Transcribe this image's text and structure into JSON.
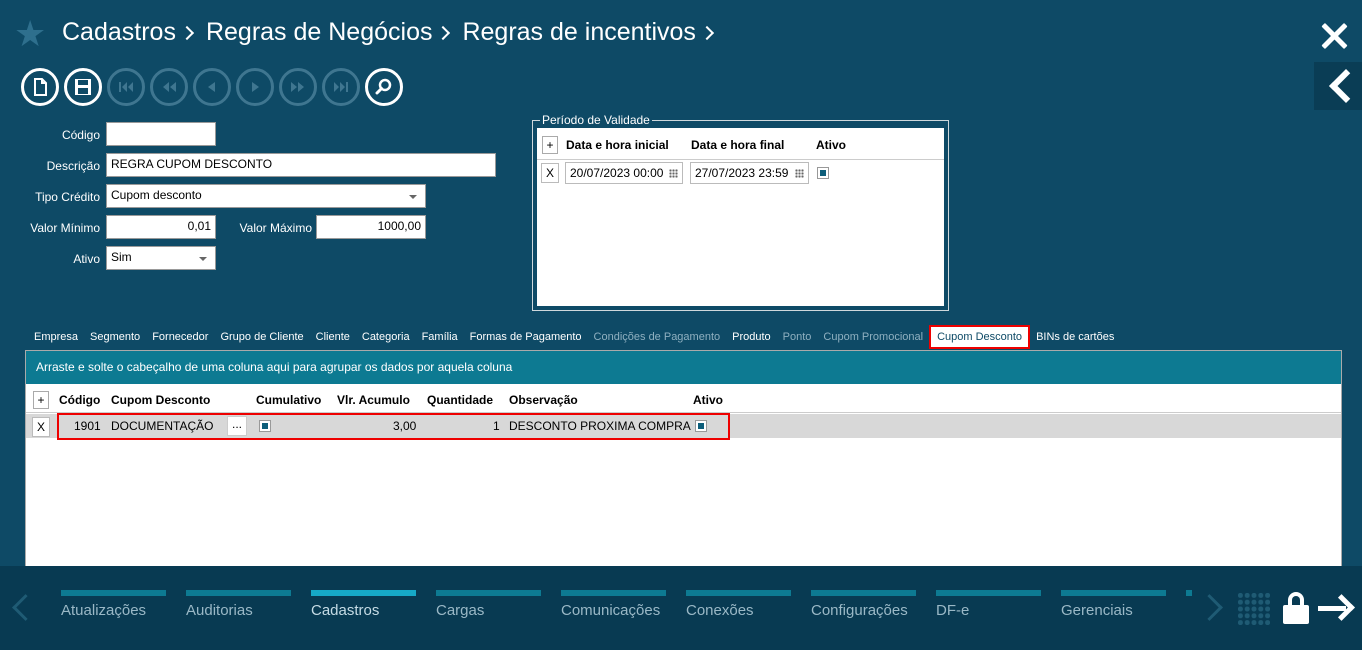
{
  "breadcrumb": [
    "Cadastros",
    "Regras de Negócios",
    "Regras de incentivos"
  ],
  "form": {
    "codigo_label": "Código",
    "codigo_value": "",
    "descricao_label": "Descrição",
    "descricao_value": "REGRA CUPOM DESCONTO",
    "tipo_credito_label": "Tipo Crédito",
    "tipo_credito_value": "Cupom desconto",
    "valor_minimo_label": "Valor Mínimo",
    "valor_minimo_value": "0,01",
    "valor_maximo_label": "Valor Máximo",
    "valor_maximo_value": "1000,00",
    "ativo_label": "Ativo",
    "ativo_value": "Sim"
  },
  "periodo": {
    "legend": "Período de Validade",
    "add": "+",
    "col_inicio": "Data e hora inicial",
    "col_fim": "Data e hora final",
    "col_ativo": "Ativo",
    "rows": [
      {
        "remove": "X",
        "inicio": "20/07/2023 00:00",
        "fim": "27/07/2023 23:59",
        "ativo": true
      }
    ]
  },
  "tabs": [
    {
      "label": "Empresa",
      "state": "normal"
    },
    {
      "label": "Segmento",
      "state": "normal"
    },
    {
      "label": "Fornecedor",
      "state": "normal"
    },
    {
      "label": "Grupo de Cliente",
      "state": "normal"
    },
    {
      "label": "Cliente",
      "state": "normal"
    },
    {
      "label": "Categoria",
      "state": "normal"
    },
    {
      "label": "Família",
      "state": "normal"
    },
    {
      "label": "Formas de Pagamento",
      "state": "normal"
    },
    {
      "label": "Condições de Pagamento",
      "state": "disabled"
    },
    {
      "label": "Produto",
      "state": "normal"
    },
    {
      "label": "Ponto",
      "state": "disabled"
    },
    {
      "label": "Cupom Promocional",
      "state": "disabled"
    },
    {
      "label": "Cupom Desconto",
      "state": "active"
    },
    {
      "label": "BINs de cartões",
      "state": "normal"
    }
  ],
  "cupom_grid": {
    "group_hint": "Arraste e solte o cabeçalho de uma coluna aqui para agrupar os dados por aquela coluna",
    "add": "+",
    "col_codigo": "Código",
    "col_cupom": "Cupom Desconto",
    "col_cumulativo": "Cumulativo",
    "col_vlr_acumulo": "Vlr. Acumulo",
    "col_quantidade": "Quantidade",
    "col_observacao": "Observação",
    "col_ativo": "Ativo",
    "rows": [
      {
        "remove": "X",
        "codigo": "1901",
        "cupom": "DOCUMENTAÇÃO",
        "lookup": "...",
        "cumulativo": true,
        "vlr_acumulo": "3,00",
        "quantidade": "1",
        "observacao": "DESCONTO PROXIMA COMPRA",
        "ativo": true
      }
    ]
  },
  "bottom_menu": [
    "Atualizações",
    "Auditorias",
    "Cadastros",
    "Cargas",
    "Comunicações",
    "Conexões",
    "Configurações",
    "DF-e",
    "Gerenciais"
  ],
  "bottom_menu_active": "Cadastros",
  "colors": {
    "background": "#0e4a66",
    "accent": "#0d7a92",
    "highlight": "#e00000"
  }
}
